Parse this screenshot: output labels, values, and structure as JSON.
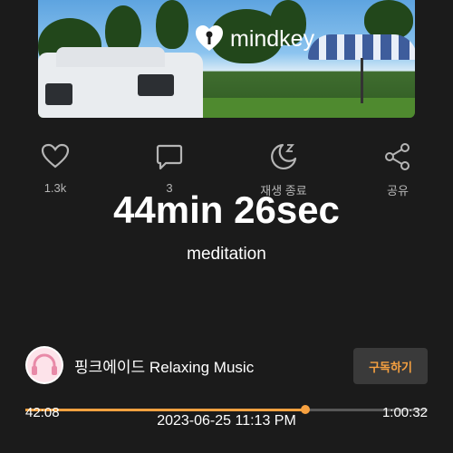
{
  "thumbnail": {
    "logo_text": "mindkey",
    "logo_icon": "mindkey-logo-icon"
  },
  "actions": [
    {
      "icon": "heart-icon",
      "label": "1.3k"
    },
    {
      "icon": "comment-icon",
      "label": "3"
    },
    {
      "icon": "sleep-timer-icon",
      "label": "재생 종료"
    },
    {
      "icon": "share-icon",
      "label": "공유"
    }
  ],
  "player": {
    "timer": "44min 26sec",
    "category": "meditation"
  },
  "channel": {
    "name": "핑크에이드 Relaxing Music",
    "avatar_icon": "headphones-avatar-icon",
    "subscribe_label": "구독하기"
  },
  "progress": {
    "elapsed": "42:08",
    "duration": "1:00:32",
    "fraction": 0.696,
    "timestamp": "2023-06-25 11:13 PM",
    "accent_color": "#f7a140"
  }
}
